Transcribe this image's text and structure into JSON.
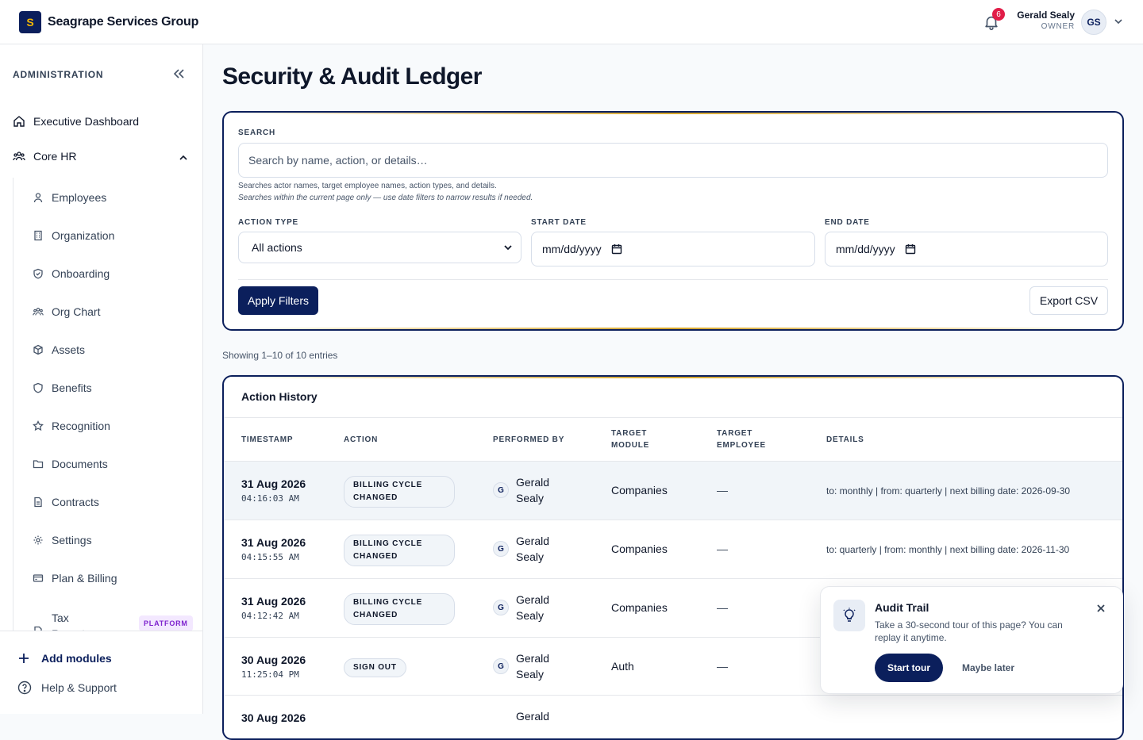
{
  "app": {
    "logo_letter": "S",
    "company": "Seagrape Services Group",
    "notifications_count": "6",
    "user": {
      "name": "Gerald Sealy",
      "role": "OWNER",
      "initials": "GS"
    }
  },
  "sidebar": {
    "heading": "ADMINISTRATION",
    "top_items": [
      {
        "label": "Executive Dashboard",
        "icon": "home-icon"
      },
      {
        "label": "Core HR",
        "icon": "people-icon"
      }
    ],
    "sub_items": [
      {
        "label": "Employees",
        "icon": "person-icon"
      },
      {
        "label": "Organization",
        "icon": "building-icon"
      },
      {
        "label": "Onboarding",
        "icon": "shield-check-icon"
      },
      {
        "label": "Org Chart",
        "icon": "people-icon"
      },
      {
        "label": "Assets",
        "icon": "box-icon"
      },
      {
        "label": "Benefits",
        "icon": "shield-icon"
      },
      {
        "label": "Recognition",
        "icon": "star-icon"
      },
      {
        "label": "Documents",
        "icon": "folder-icon"
      },
      {
        "label": "Contracts",
        "icon": "document-icon"
      },
      {
        "label": "Settings",
        "icon": "gear-icon"
      },
      {
        "label": "Plan & Billing",
        "icon": "credit-card-icon"
      },
      {
        "label": "Tax Reports",
        "icon": "document-icon"
      }
    ],
    "platform_badge": "PLATFORM",
    "add_modules": "Add modules",
    "help": "Help & Support"
  },
  "page": {
    "title": "Security & Audit Ledger",
    "search_label": "SEARCH",
    "search_placeholder": "Search by name, action, or details…",
    "hint1": "Searches actor names, target employee names, action types, and details.",
    "hint2": "Searches within the current page only — use date filters to narrow results if needed.",
    "action_type_label": "ACTION TYPE",
    "action_type_value": "All actions",
    "start_date_label": "START DATE",
    "start_date_value": "mm/dd/yyyy",
    "end_date_label": "END DATE",
    "end_date_value": "mm/dd/yyyy",
    "apply_button": "Apply Filters",
    "export_button": "Export CSV",
    "showing": "Showing 1–10 of 10 entries"
  },
  "table": {
    "title": "Action History",
    "headers": {
      "timestamp": "TIMESTAMP",
      "action": "ACTION",
      "performed_by": "PERFORMED BY",
      "target_module_1": "TARGET",
      "target_module_2": "MODULE",
      "target_employee_1": "TARGET",
      "target_employee_2": "EMPLOYEE",
      "details": "DETAILS"
    },
    "rows": [
      {
        "date": "31 Aug 2026",
        "time": "04:16:03 AM",
        "action_1": "BILLING CYCLE",
        "action_2": "CHANGED",
        "initial": "G",
        "performer_1": "Gerald",
        "performer_2": "Sealy",
        "module": "Companies",
        "target": "—",
        "details": "to: monthly | from: quarterly | next billing date: 2026-09-30"
      },
      {
        "date": "31 Aug 2026",
        "time": "04:15:55 AM",
        "action_1": "BILLING CYCLE",
        "action_2": "CHANGED",
        "initial": "G",
        "performer_1": "Gerald",
        "performer_2": "Sealy",
        "module": "Companies",
        "target": "—",
        "details": "to: quarterly | from: monthly | next billing date: 2026-11-30"
      },
      {
        "date": "31 Aug 2026",
        "time": "04:12:42 AM",
        "action_1": "BILLING CYCLE",
        "action_2": "CHANGED",
        "initial": "G",
        "performer_1": "Gerald",
        "performer_2": "Sealy",
        "module": "Companies",
        "target": "—",
        "details": ""
      },
      {
        "date": "30 Aug 2026",
        "time": "11:25:04 PM",
        "action_1": "SIGN OUT",
        "action_2": "",
        "initial": "G",
        "performer_1": "Gerald",
        "performer_2": "Sealy",
        "module": "Auth",
        "target": "—",
        "details": ""
      },
      {
        "date": "30 Aug 2026",
        "time": "",
        "action_1": "",
        "action_2": "",
        "initial": "",
        "performer_1": "Gerald",
        "performer_2": "",
        "module": "",
        "target": "",
        "details": ""
      }
    ]
  },
  "tour": {
    "title": "Audit Trail",
    "text": "Take a 30-second tour of this page? You can replay it anytime.",
    "start": "Start tour",
    "later": "Maybe later"
  },
  "colors": {
    "navy": "#0b1f5c",
    "gold": "#d6a62b",
    "badge_red": "#e11d48",
    "platform_purple": "#7e22ce"
  }
}
